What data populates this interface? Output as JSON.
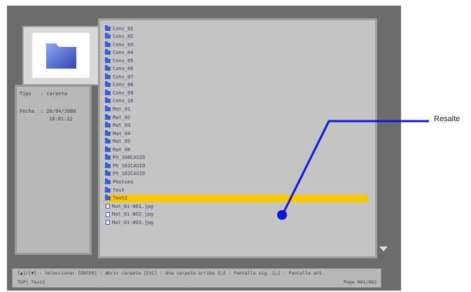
{
  "info": {
    "type_label": "Tipo",
    "type_value": ": carpeta",
    "date_label": "Fecha",
    "date_value": ": 28/04/2000",
    "time_value": "18:01:32"
  },
  "files": [
    {
      "name": "Conv_01",
      "kind": "folder"
    },
    {
      "name": "Conv_02",
      "kind": "folder"
    },
    {
      "name": "Conv_03",
      "kind": "folder"
    },
    {
      "name": "Conv_04",
      "kind": "folder"
    },
    {
      "name": "Conv_05",
      "kind": "folder"
    },
    {
      "name": "Conv_06",
      "kind": "folder"
    },
    {
      "name": "Conv_07",
      "kind": "folder"
    },
    {
      "name": "Conv_08",
      "kind": "folder"
    },
    {
      "name": "Conv_09",
      "kind": "folder"
    },
    {
      "name": "Conv_10",
      "kind": "folder"
    },
    {
      "name": "Mat_01",
      "kind": "folder"
    },
    {
      "name": "Mat_02",
      "kind": "folder"
    },
    {
      "name": "Mat_03",
      "kind": "folder"
    },
    {
      "name": "Mat_04",
      "kind": "folder"
    },
    {
      "name": "Mat_05",
      "kind": "folder"
    },
    {
      "name": "Mat_06",
      "kind": "folder"
    },
    {
      "name": "Ph_100CASIO",
      "kind": "folder"
    },
    {
      "name": "Ph_101CASIO",
      "kind": "folder"
    },
    {
      "name": "Ph_102CASIO",
      "kind": "folder"
    },
    {
      "name": "Photoes",
      "kind": "folder"
    },
    {
      "name": "Test",
      "kind": "folder"
    },
    {
      "name": "Test2",
      "kind": "folder",
      "selected": true
    },
    {
      "name": "Mat_01-001.jpg",
      "kind": "file"
    },
    {
      "name": "Mat_01-002.jpg",
      "kind": "file"
    },
    {
      "name": "Mat_01-003.jpg",
      "kind": "file"
    }
  ],
  "help": {
    "keys_text": "[▲]/[▼] : Seleccionar  [ENTER] : Abrir carpeta  [ESC] : Una carpeta arriba  [□] : Pantalla sig.  [△] : Pantalla ant.",
    "path_text": "TOP) Test2",
    "page_text": "Page 001/002"
  },
  "callout": {
    "label": "Resalte"
  },
  "colors": {
    "highlight": "#f5c800",
    "folder": "#3a5fd0",
    "callout_line": "#0a1ad8"
  }
}
